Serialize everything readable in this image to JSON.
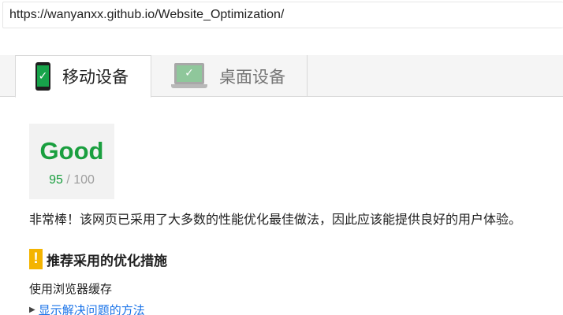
{
  "url_bar": {
    "value": "https://wanyanxx.github.io/Website_Optimization/"
  },
  "tabs": [
    {
      "label": "移动设备",
      "icon": "mobile-phone-icon",
      "active": true
    },
    {
      "label": "桌面设备",
      "icon": "laptop-icon",
      "active": false
    }
  ],
  "score": {
    "label": "Good",
    "value": "95",
    "max": "/ 100"
  },
  "summary": "非常棒！该网页已采用了大多数的性能优化最佳做法，因此应该能提供良好的用户体验。",
  "suggestions": {
    "warning_glyph": "!",
    "title": "推荐采用的优化措施",
    "rule": "使用浏览器缓存",
    "show_fix": "显示解决问题的方法"
  },
  "colors": {
    "good": "#1a9f3f",
    "warning": "#f4b400",
    "link": "#1a73e8"
  }
}
